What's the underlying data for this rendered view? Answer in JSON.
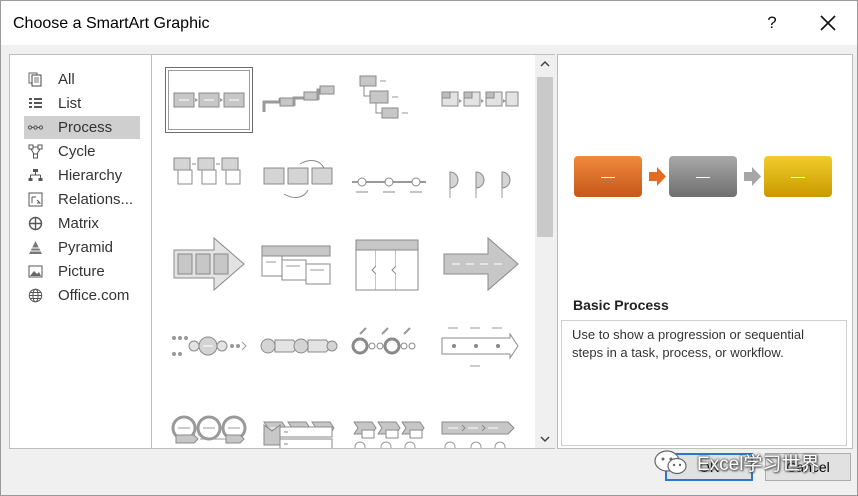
{
  "dialog": {
    "title": "Choose a SmartArt Graphic",
    "help_label": "?"
  },
  "categories": [
    {
      "label": "All",
      "icon": "all-icon"
    },
    {
      "label": "List",
      "icon": "list-icon"
    },
    {
      "label": "Process",
      "icon": "process-icon",
      "selected": true
    },
    {
      "label": "Cycle",
      "icon": "cycle-icon"
    },
    {
      "label": "Hierarchy",
      "icon": "hierarchy-icon"
    },
    {
      "label": "Relations...",
      "icon": "relationship-icon"
    },
    {
      "label": "Matrix",
      "icon": "matrix-icon"
    },
    {
      "label": "Pyramid",
      "icon": "pyramid-icon"
    },
    {
      "label": "Picture",
      "icon": "picture-icon"
    },
    {
      "label": "Office.com",
      "icon": "globe-icon"
    }
  ],
  "gallery": {
    "selected_layout": "Basic Process"
  },
  "preview": {
    "name": "Basic Process",
    "description": "Use to show a progression or sequential steps in a task, process, or workflow.",
    "box_text": "—",
    "colors": {
      "first": "#e46c22",
      "second": "#8c8c8c",
      "third": "#e2b400",
      "arrow_first": "#e46c22",
      "arrow_second": "#a6a6a6"
    }
  },
  "buttons": {
    "ok": "OK",
    "cancel": "Cancel"
  },
  "watermark": {
    "text": "Excel学习世界"
  }
}
